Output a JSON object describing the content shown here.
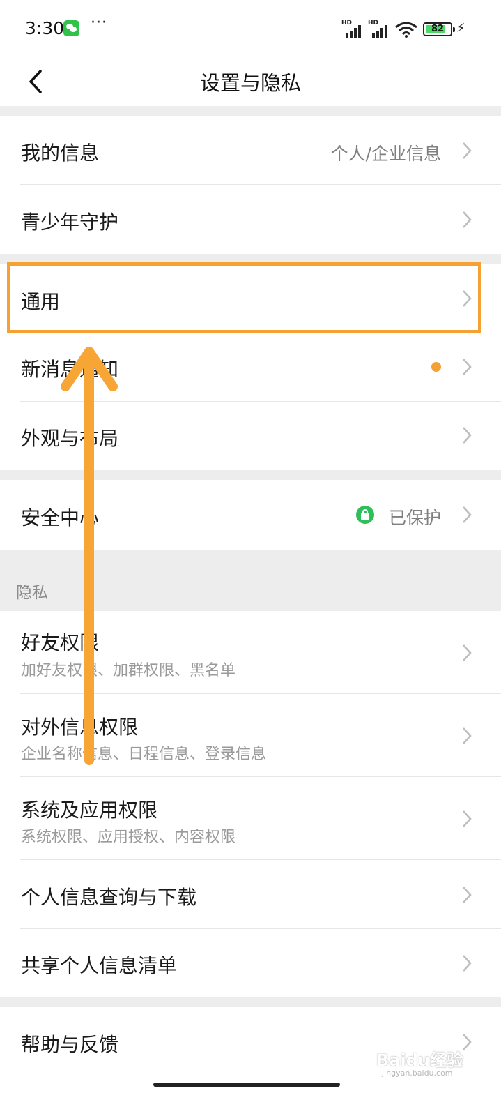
{
  "status_bar": {
    "time": "3:30",
    "more": "···",
    "signal_1_label": "HD",
    "signal_2_label": "HD",
    "battery_percent": "82",
    "charging": "⚡"
  },
  "header": {
    "back_icon": "chevron-left-icon",
    "title": "设置与隐私"
  },
  "groups": {
    "account": [
      {
        "label": "我的信息",
        "value": "个人/企业信息"
      },
      {
        "label": "青少年守护"
      }
    ],
    "general": [
      {
        "label": "通用"
      },
      {
        "label": "新消息通知",
        "badge": "dot"
      },
      {
        "label": "外观与布局"
      }
    ],
    "security": [
      {
        "label": "安全中心",
        "value": "已保护",
        "icon": "lock-icon"
      }
    ],
    "privacy_header": "隐私",
    "privacy": [
      {
        "label": "好友权限",
        "sub": "加好友权限、加群权限、黑名单"
      },
      {
        "label": "对外信息权限",
        "sub": "企业名称信息、日程信息、登录信息"
      },
      {
        "label": "系统及应用权限",
        "sub": "系统权限、应用授权、内容权限"
      },
      {
        "label": "个人信息查询与下载"
      },
      {
        "label": "共享个人信息清单"
      }
    ],
    "help": [
      {
        "label": "帮助与反馈"
      }
    ]
  },
  "annotation": {
    "highlight_color": "#f5a233",
    "arrow_color": "#f7a535"
  },
  "watermark": {
    "text": "Baidu经验",
    "sub": "jingyan.baidu.com"
  },
  "colors": {
    "background": "#ededed",
    "surface": "#ffffff",
    "secondary_text": "#9a9a9a",
    "notification_dot": "#f5a033",
    "secure_green": "#2ebf5c"
  }
}
